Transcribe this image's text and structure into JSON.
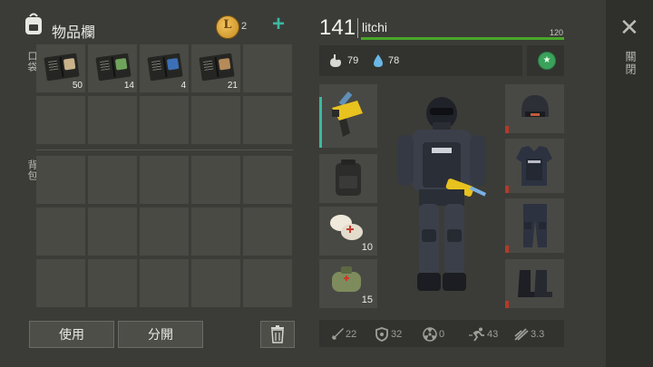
{
  "header": {
    "title": "物品欄",
    "coin_symbol": "L",
    "coin_count": "2",
    "add_symbol": "+"
  },
  "inventory": {
    "pocket_label": "口袋",
    "backpack_label": "背包",
    "pocket_items": [
      {
        "count": "50",
        "plate_color": "#c9b18a"
      },
      {
        "count": "14",
        "plate_color": "#6fa35b"
      },
      {
        "count": "4",
        "plate_color": "#3c6fb5"
      },
      {
        "count": "21",
        "plate_color": "#b58b5a"
      }
    ]
  },
  "actions": {
    "use_label": "使用",
    "split_label": "分開"
  },
  "character": {
    "level": "141",
    "name": "litchi",
    "hp": "120",
    "hp_fraction": 1.0,
    "food": "79",
    "water": "78",
    "skill_symbol": "★"
  },
  "equipment": {
    "backpack_count": "10",
    "medkit_count": "15"
  },
  "bottom_stats": {
    "attack": "22",
    "defense": "32",
    "radiation": "0",
    "speed": "43",
    "stealth": "3.3"
  },
  "close": {
    "symbol": "✕",
    "label": "關閉"
  },
  "colors": {
    "accent_teal": "#3bb8a1",
    "hp_green": "#4aa52a",
    "durability_red": "#b23a2a"
  }
}
